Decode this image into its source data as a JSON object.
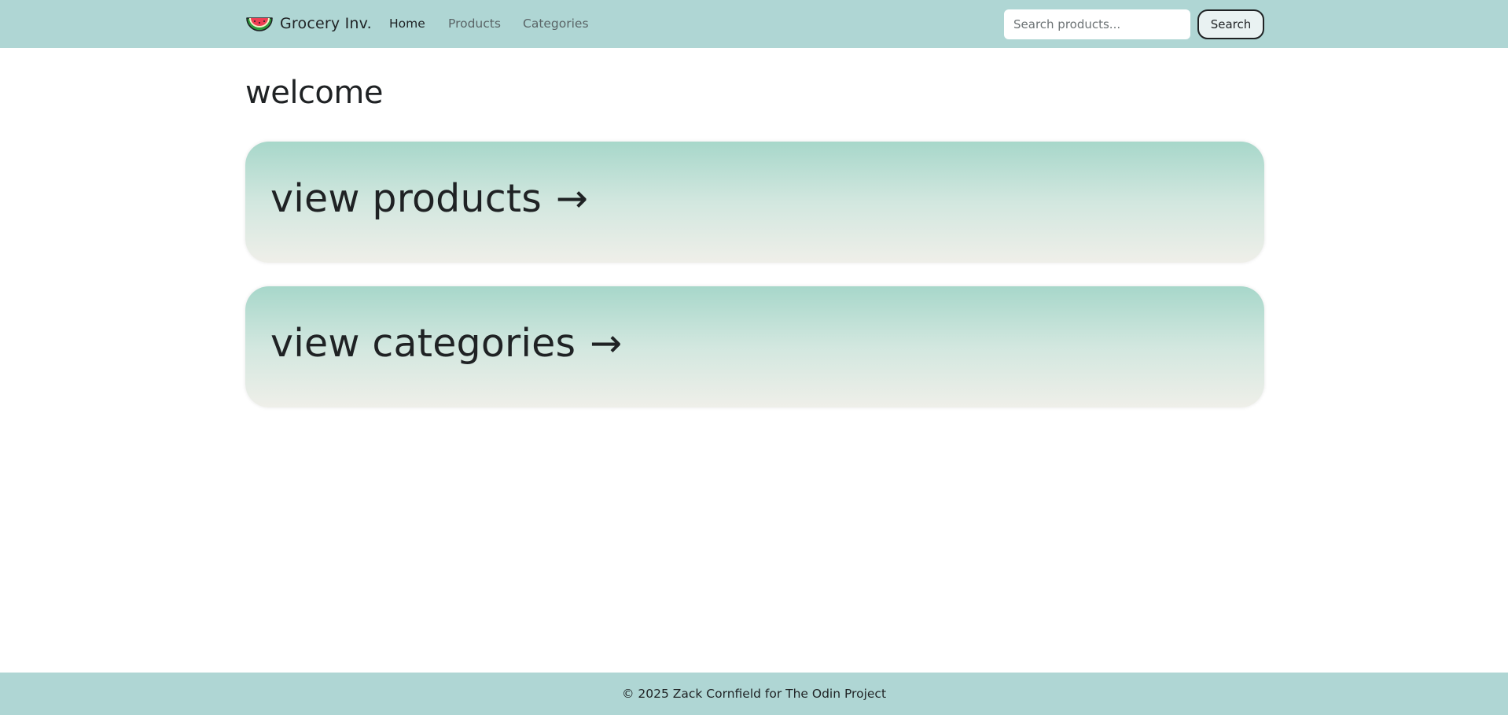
{
  "navbar": {
    "logo_icon": "watermelon-icon",
    "brand": "Grocery Inv.",
    "links": [
      {
        "label": "Home",
        "active": true
      },
      {
        "label": "Products",
        "active": false
      },
      {
        "label": "Categories",
        "active": false
      }
    ],
    "search": {
      "placeholder": "Search products...",
      "value": "",
      "button_label": "Search"
    }
  },
  "main": {
    "title": "welcome",
    "cards": [
      {
        "label": "view products",
        "arrow": "→"
      },
      {
        "label": "view categories",
        "arrow": "→"
      }
    ]
  },
  "footer": {
    "text": "© 2025 Zack Cornfield for The Odin Project"
  },
  "colors": {
    "header_bg": "#afd6d4",
    "footer_bg": "#afd6d4",
    "card_gradient_top": "#a7d7ca",
    "card_gradient_bottom": "#efefe9",
    "text": "#1f2224"
  }
}
